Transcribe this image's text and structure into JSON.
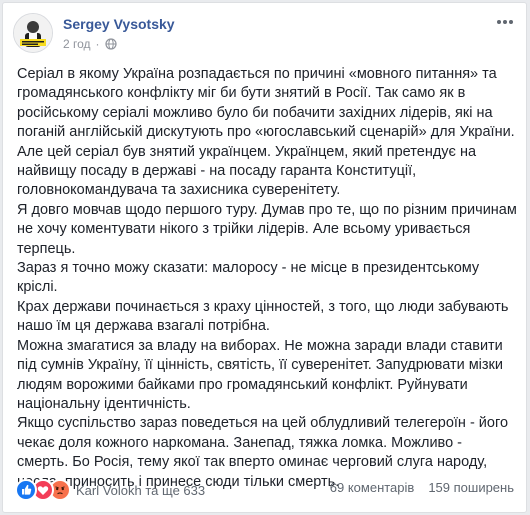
{
  "post": {
    "author": "Sergey Vysotsky",
    "time": "2 год",
    "visibility_icon": "globe-icon",
    "more_icon": "ellipsis-icon",
    "paragraphs": [
      "Серіал в якому Україна розпадається по причині «мовного питання» та громадянського конфлікту міг би бути знятий в Росії. Так само як в російському серіалі можливо було би побачити західних лідерів, які на поганій англійській дискутують про «югославський сценарій» для України. Але цей серіал був знятий українцем. Українцем, який претендує на найвищу посаду в державі - на посаду гаранта Конституції, головнокомандувача та захисника суверенітету.",
      "Я довго мовчав щодо першого туру. Думав про те, що по різним причинам не хочу коментувати нікого з трійки лідерів. Але всьому уривається терпець.",
      "Зараз я точно можу сказати: малоросу - не місце в президентському кріслі.",
      "Крах держави починається з краху цінностей, з того, що люди забувають нашо їм ця держава взагалі потрібна.",
      "Можна змагатися за владу на виборах. Не можна заради влади ставити під сумнів Україну, її цінність, святість, її суверенітет. Запудрювати мізки людям ворожими байками про громадянський конфлікт. Руйнувати національну ідентичність.",
      "Якщо суспільство зараз поведеться на цей облудливий телегероїн - його чекає доля кожного наркомана. Занепад, тяжка ломка. Можливо - смерть. Бо Росія, тему якої так вперто оминає черговий слуга народу, несла, приносить і принесе сюди тільки смерть."
    ]
  },
  "footer": {
    "reaction_icons": [
      "like-reaction-icon",
      "love-reaction-icon",
      "angry-reaction-icon"
    ],
    "likers": "Karl Volokh та ще 633",
    "comments": "69 коментарів",
    "shares": "159 поширень"
  },
  "colors": {
    "author_link": "#385898",
    "text": "#1d2129",
    "muted": "#90949c",
    "like": "#1877f2",
    "love": "#f33e58",
    "angry": "#f7714c",
    "page_bg": "#e9ebee"
  }
}
